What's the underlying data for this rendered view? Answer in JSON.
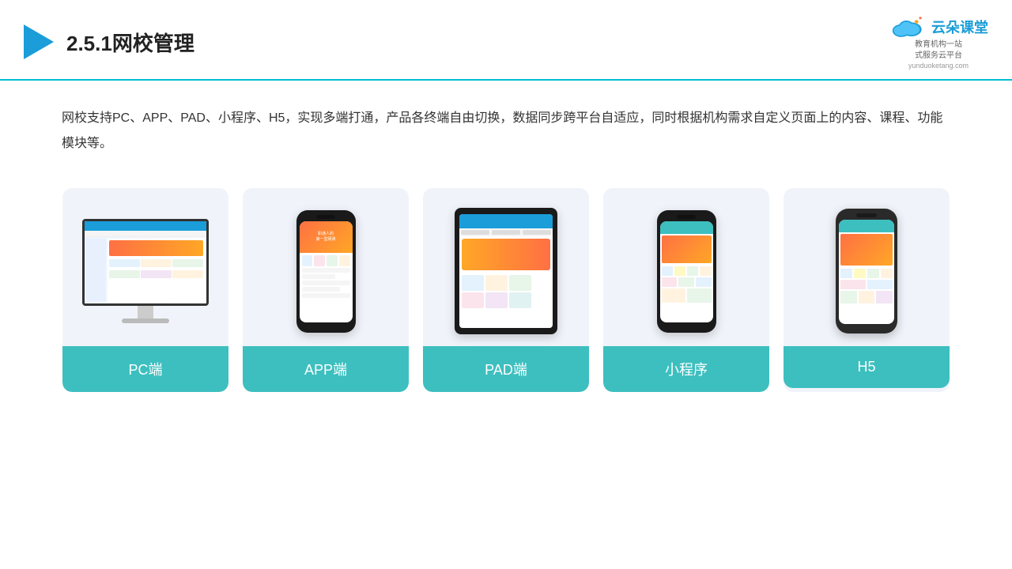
{
  "header": {
    "title": "2.5.1网校管理",
    "brand_name": "云朵课堂",
    "brand_url": "yunduoketang.com",
    "brand_subtitle_line1": "教育机构一站",
    "brand_subtitle_line2": "式服务云平台"
  },
  "description": {
    "text": "网校支持PC、APP、PAD、小程序、H5，实现多端打通，产品各终端自由切换，数据同步跨平台自适应，同时根据机构需求自定义页面上的内容、课程、功能模块等。"
  },
  "cards": [
    {
      "id": "pc",
      "label": "PC端"
    },
    {
      "id": "app",
      "label": "APP端"
    },
    {
      "id": "pad",
      "label": "PAD端"
    },
    {
      "id": "miniprogram",
      "label": "小程序"
    },
    {
      "id": "h5",
      "label": "H5"
    }
  ],
  "colors": {
    "accent": "#3dbfbf",
    "header_line": "#00bcd4",
    "brand_blue": "#1a9dd9"
  }
}
